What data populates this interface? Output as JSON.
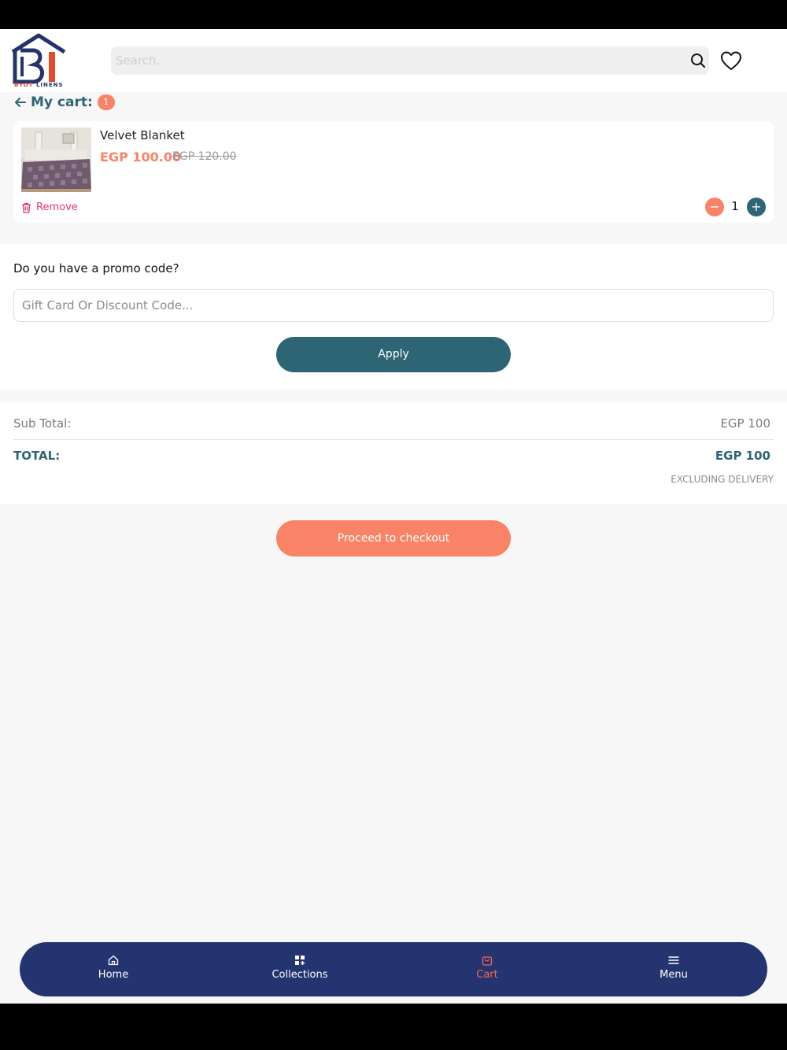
{
  "brand": {
    "logo_text_1": "BYOT",
    "logo_text_2": "LINENS"
  },
  "header": {
    "search_placeholder": "Search."
  },
  "cart": {
    "title": "My cart:",
    "count": "1",
    "item": {
      "name": "Velvet Blanket",
      "price": "EGP 100.00",
      "old_price": "EGP 120.00",
      "remove_label": "Remove",
      "quantity": "1",
      "minus": "−",
      "plus": "+"
    }
  },
  "promo": {
    "question": "Do you have a promo code?",
    "placeholder": "Gift Card Or Discount Code...",
    "apply_label": "Apply"
  },
  "totals": {
    "sub_total_label": "Sub Total:",
    "sub_total_value": "EGP 100",
    "total_label": "TOTAL:",
    "total_value": "EGP 100",
    "note": "EXCLUDING DELIVERY"
  },
  "checkout_label": "Proceed to checkout",
  "nav": {
    "items": [
      {
        "label": "Home",
        "icon": "home-icon"
      },
      {
        "label": "Collections",
        "icon": "grid-icon"
      },
      {
        "label": "Cart",
        "icon": "bag-icon"
      },
      {
        "label": "Menu",
        "icon": "menu-icon"
      }
    ],
    "active": "Cart"
  },
  "colors": {
    "brand_navy": "#243470",
    "teal": "#2d6575",
    "coral": "#f98366",
    "remove_pink": "#e1337a"
  }
}
